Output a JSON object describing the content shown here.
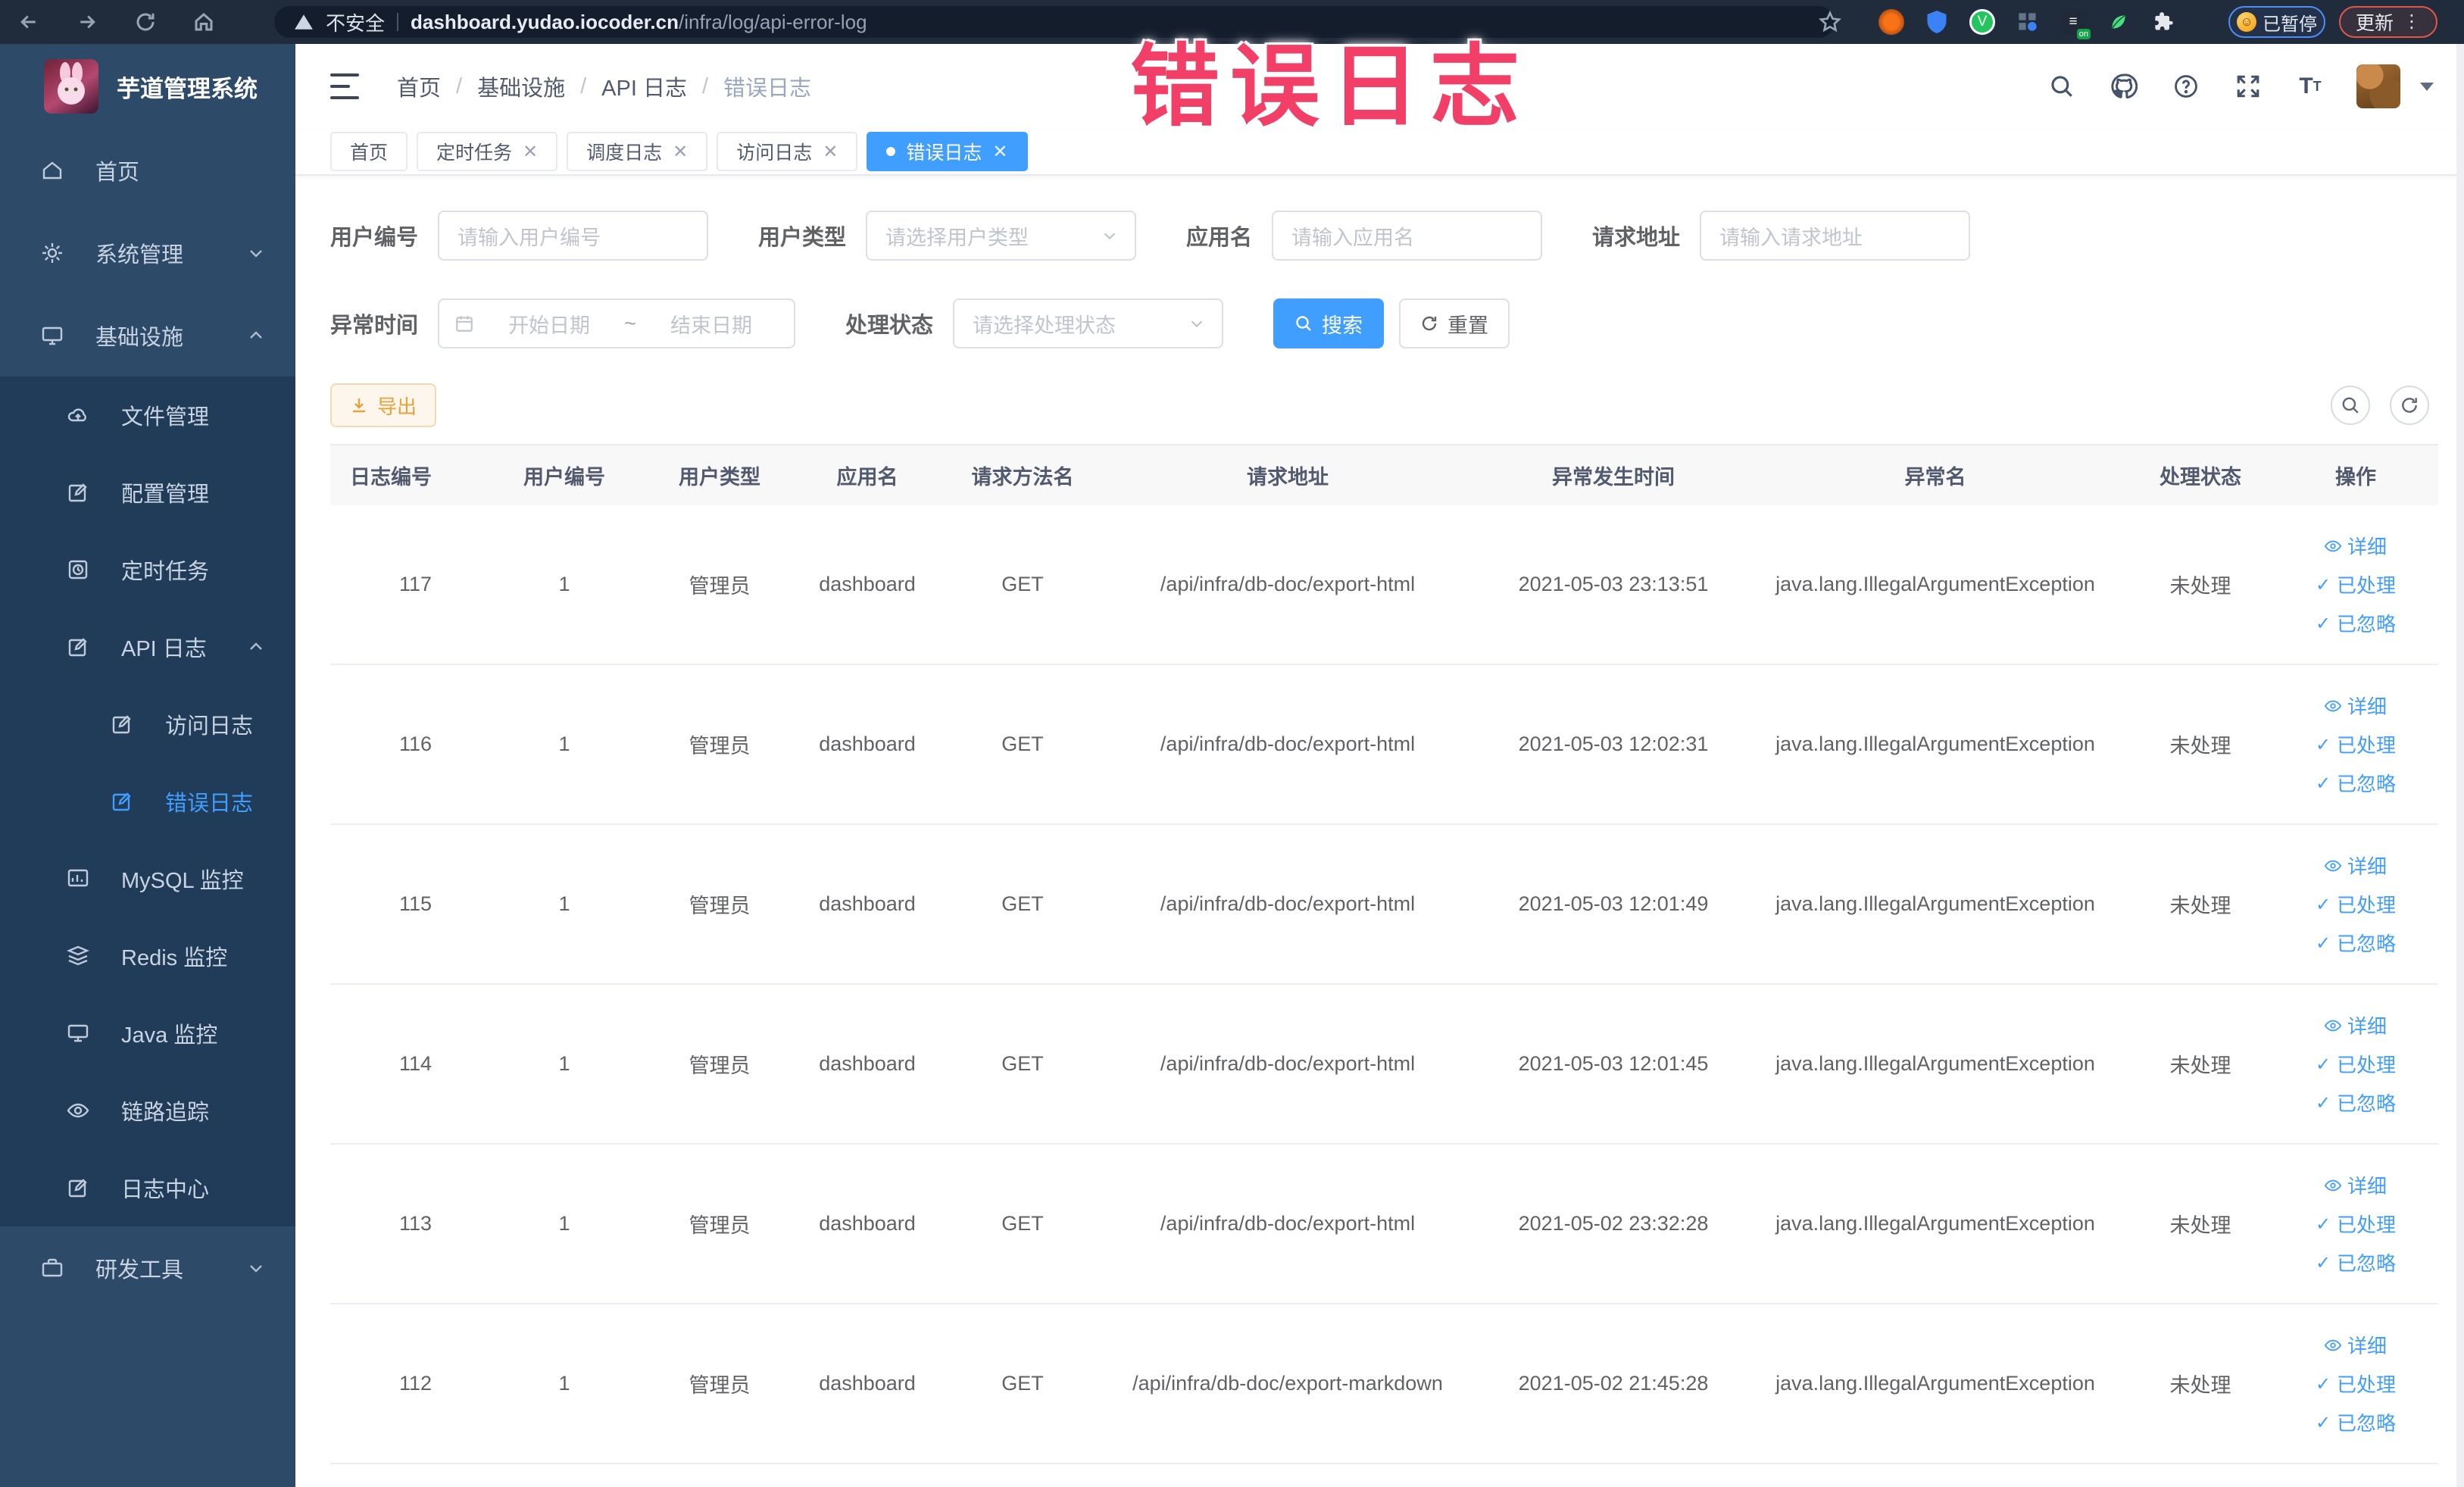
{
  "browser": {
    "security_label": "不安全",
    "url_host": "dashboard.yudao.iocoder.cn",
    "url_path": "/infra/log/api-error-log",
    "paused_chip": "已暂停",
    "update_chip": "更新"
  },
  "overlay": {
    "text": "错误日志",
    "color": "#f23f68"
  },
  "sidebar": {
    "title": "芋道管理系统",
    "items": [
      {
        "label": "首页"
      },
      {
        "label": "系统管理"
      },
      {
        "label": "基础设施"
      },
      {
        "label": "文件管理"
      },
      {
        "label": "配置管理"
      },
      {
        "label": "定时任务"
      },
      {
        "label": "API 日志"
      },
      {
        "label": "访问日志"
      },
      {
        "label": "错误日志"
      },
      {
        "label": "MySQL 监控"
      },
      {
        "label": "Redis 监控"
      },
      {
        "label": "Java 监控"
      },
      {
        "label": "链路追踪"
      },
      {
        "label": "日志中心"
      },
      {
        "label": "研发工具"
      }
    ]
  },
  "breadcrumb": {
    "items": [
      "首页",
      "基础设施",
      "API 日志",
      "错误日志"
    ],
    "separator": "/"
  },
  "tabs": [
    {
      "label": "首页"
    },
    {
      "label": "定时任务"
    },
    {
      "label": "调度日志"
    },
    {
      "label": "访问日志"
    },
    {
      "label": "错误日志"
    }
  ],
  "filters": {
    "user_id": {
      "label": "用户编号",
      "placeholder": "请输入用户编号"
    },
    "user_type": {
      "label": "用户类型",
      "placeholder": "请选择用户类型"
    },
    "app_name": {
      "label": "应用名",
      "placeholder": "请输入应用名"
    },
    "request_url": {
      "label": "请求地址",
      "placeholder": "请输入请求地址"
    },
    "exception_time": {
      "label": "异常时间",
      "start_placeholder": "开始日期",
      "separator": "~",
      "end_placeholder": "结束日期"
    },
    "process_status": {
      "label": "处理状态",
      "placeholder": "请选择处理状态"
    },
    "search_button": "搜索",
    "reset_button": "重置"
  },
  "toolbar": {
    "export_button": "导出"
  },
  "table": {
    "columns": [
      "日志编号",
      "用户编号",
      "用户类型",
      "应用名",
      "请求方法名",
      "请求地址",
      "异常发生时间",
      "异常名",
      "处理状态",
      "操作"
    ],
    "actions": [
      "详细",
      "已处理",
      "已忽略"
    ],
    "rows": [
      {
        "id": "117",
        "user_id": "1",
        "user_type": "管理员",
        "app": "dashboard",
        "method": "GET",
        "url": "/api/infra/db-doc/export-html",
        "time": "2021-05-03 23:13:51",
        "exception": "java.lang.IllegalArgumentException",
        "status": "未处理"
      },
      {
        "id": "116",
        "user_id": "1",
        "user_type": "管理员",
        "app": "dashboard",
        "method": "GET",
        "url": "/api/infra/db-doc/export-html",
        "time": "2021-05-03 12:02:31",
        "exception": "java.lang.IllegalArgumentException",
        "status": "未处理"
      },
      {
        "id": "115",
        "user_id": "1",
        "user_type": "管理员",
        "app": "dashboard",
        "method": "GET",
        "url": "/api/infra/db-doc/export-html",
        "time": "2021-05-03 12:01:49",
        "exception": "java.lang.IllegalArgumentException",
        "status": "未处理"
      },
      {
        "id": "114",
        "user_id": "1",
        "user_type": "管理员",
        "app": "dashboard",
        "method": "GET",
        "url": "/api/infra/db-doc/export-html",
        "time": "2021-05-03 12:01:45",
        "exception": "java.lang.IllegalArgumentException",
        "status": "未处理"
      },
      {
        "id": "113",
        "user_id": "1",
        "user_type": "管理员",
        "app": "dashboard",
        "method": "GET",
        "url": "/api/infra/db-doc/export-html",
        "time": "2021-05-02 23:32:28",
        "exception": "java.lang.IllegalArgumentException",
        "status": "未处理"
      },
      {
        "id": "112",
        "user_id": "1",
        "user_type": "管理员",
        "app": "dashboard",
        "method": "GET",
        "url": "/api/infra/db-doc/export-markdown",
        "time": "2021-05-02 21:45:28",
        "exception": "java.lang.IllegalArgumentException",
        "status": "未处理"
      }
    ]
  },
  "colors": {
    "primary": "#409eff",
    "warning": "#e6a23c",
    "sidebar_bg": "#2d4a69",
    "submenu_bg": "#203c58",
    "chrome_bg": "#202b3c"
  }
}
